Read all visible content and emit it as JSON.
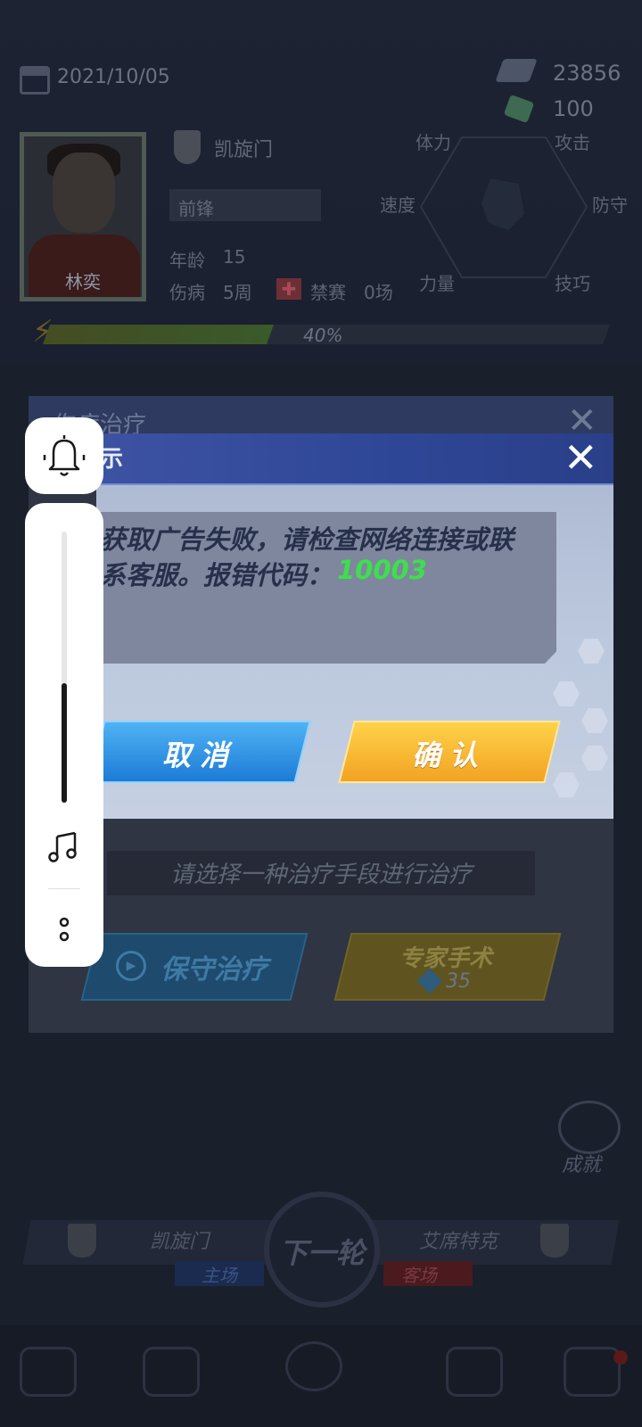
{
  "status": {
    "date": "2021/10/05",
    "coins": "23856",
    "gems": "100"
  },
  "player": {
    "name": "林奕",
    "club": "凯旋门",
    "position": "前锋",
    "age_label": "年龄",
    "age": "15",
    "injury_label": "伤病",
    "injury": "5周",
    "ban_label": "禁赛",
    "ban": "0场",
    "stats": [
      "体力",
      "攻击",
      "速度",
      "防守",
      "力量",
      "技巧"
    ],
    "stamina_percent": "40%",
    "stamina_value": 0.4
  },
  "injury_dialog": {
    "title": "伤病治疗",
    "prompt": "请选择一种治疗手段进行治疗",
    "conservative_label": "保守治疗",
    "expert_label": "专家手术",
    "expert_cost": "35"
  },
  "popup": {
    "title": "示",
    "message_line1": "获取广告失败，请检查网络连接或联",
    "message_line2": "系客服。报错代码：",
    "error_code": "10003",
    "cancel_label": "取消",
    "confirm_label": "确认"
  },
  "bottom": {
    "achievement_label": "成就",
    "home_team": "凯旋门",
    "home_tag": "主场",
    "away_team": "艾席特克",
    "away_tag": "客场",
    "next_round_label": "下一轮"
  },
  "volume": {
    "level": 0.44
  },
  "colors": {
    "error_code": "#3ce04a",
    "cancel_button": "#1d7bd6",
    "confirm_button": "#f2a322",
    "popup_header": "#2e4696"
  }
}
